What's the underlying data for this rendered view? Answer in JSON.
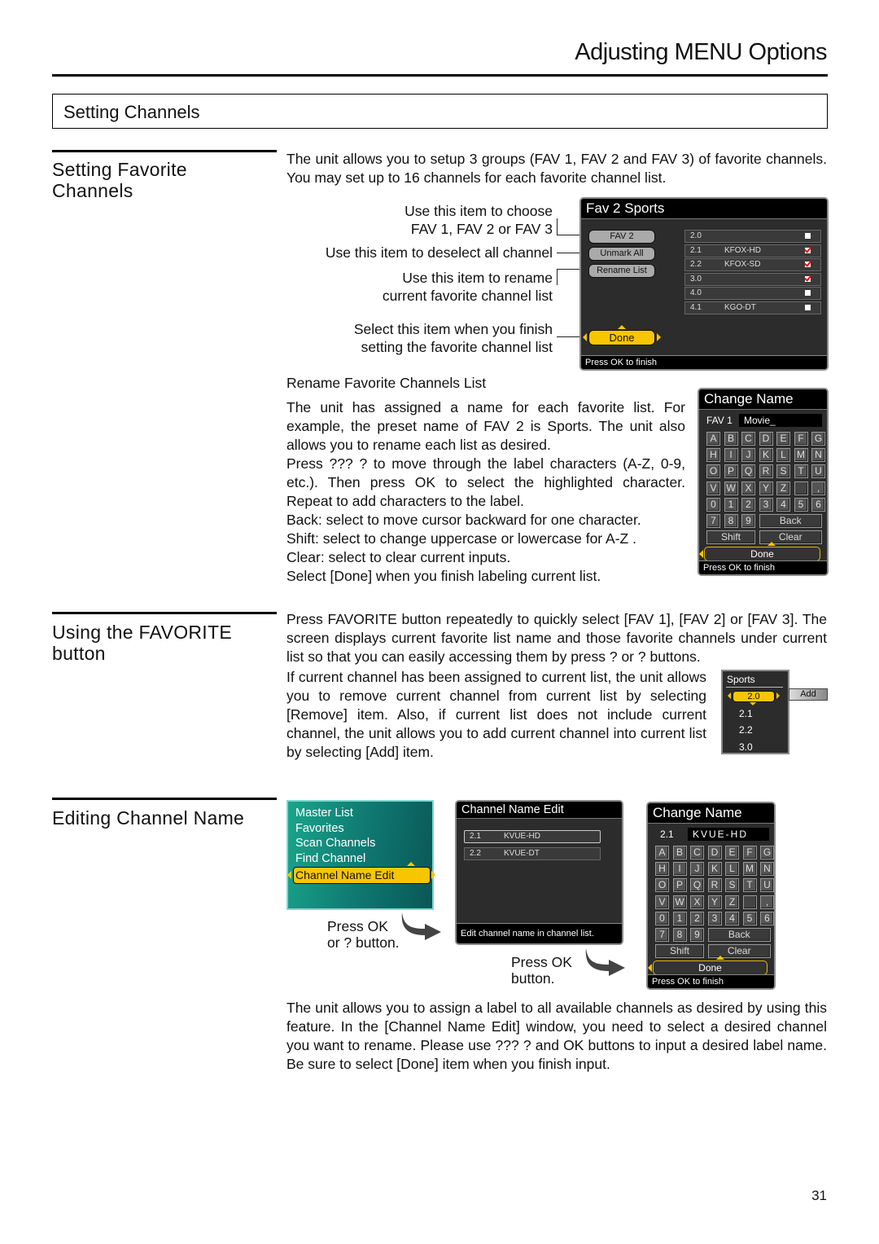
{
  "header": {
    "title": "Adjusting MENU Options"
  },
  "section": {
    "title": "Setting Channels"
  },
  "fav_section": {
    "heading": [
      "Setting Favorite",
      "Channels"
    ],
    "intro": "The unit allows you to setup 3 groups (FAV 1, FAV 2 and FAV 3) of favorite channels. You may set up to 16 channels for each favorite channel list.",
    "callouts": {
      "choose": [
        "Use this item to choose",
        "FAV 1, FAV 2 or FAV 3"
      ],
      "deselect": "Use this item to deselect all channel",
      "rename": [
        "Use this item to rename",
        "current favorite channel list"
      ],
      "finish": [
        "Select this item when you finish",
        "setting the favorite channel list"
      ]
    },
    "osd": {
      "title": "Fav 2 Sports",
      "buttons": {
        "fav": "FAV 2",
        "unmark": "Unmark All",
        "rename": "Rename List",
        "done": "Done"
      },
      "channels": [
        {
          "num": "2.0",
          "name": "",
          "checked": false
        },
        {
          "num": "2.1",
          "name": "KFOX-HD",
          "checked": true
        },
        {
          "num": "2.2",
          "name": "KFOX-SD",
          "checked": true
        },
        {
          "num": "3.0",
          "name": "",
          "checked": true
        },
        {
          "num": "4.0",
          "name": "",
          "checked": false
        },
        {
          "num": "4.1",
          "name": "KGO-DT",
          "checked": false
        }
      ],
      "footer": "Press OK to finish"
    }
  },
  "rename_section": {
    "subheading": "Rename Favorite Channels List",
    "paragraphs": [
      "The unit has assigned a name for each favorite list. For example, the preset name of FAV 2 is Sports. The unit also allows you to rename each list as desired.",
      "Press ??? ? to move through the label characters (A-Z, 0-9, etc.). Then press OK to select the highlighted character. Repeat to add characters to the label.",
      "Back: select to move cursor backward for one character.",
      "Shift: select to change uppercase or lowercase for A-Z .",
      "Clear: select to clear current inputs.",
      "Select [Done] when you finish labeling current list."
    ],
    "osd": {
      "title": "Change Name",
      "label": "FAV 1",
      "value": "Movie_",
      "footer": "Press OK to finish"
    }
  },
  "keyboard": {
    "rows": [
      [
        "A",
        "B",
        "C",
        "D",
        "E",
        "F",
        "G"
      ],
      [
        "H",
        "I",
        "J",
        "K",
        "L",
        "M",
        "N"
      ],
      [
        "O",
        "P",
        "Q",
        "R",
        "S",
        "T",
        "U"
      ],
      [
        "V",
        "W",
        "X",
        "Y",
        "Z",
        " ",
        ","
      ],
      [
        "0",
        "1",
        "2",
        "3",
        "4",
        "5",
        "6"
      ],
      [
        "7",
        "8",
        "9"
      ]
    ],
    "back": "Back",
    "shift": "Shift",
    "clear": "Clear",
    "done": "Done"
  },
  "favorite_button_section": {
    "heading": [
      "Using the FAVORITE",
      "button"
    ],
    "paragraph1": "Press FAVORITE button repeatedly to quickly select [FAV 1], [FAV 2] or [FAV 3]. The screen displays current favorite list name and those favorite channels under current list so that you can easily accessing them by press ? or ? buttons.",
    "paragraph2": "If current channel has been assigned to current list, the unit allows you to remove current channel from current list by selecting [Remove] item. Also, if current list does not include current channel, the unit allows you to add current channel into current list by selecting [Add] item.",
    "osd": {
      "title": "Sports",
      "channels": [
        "2.0",
        "2.1",
        "2.2",
        "3.0"
      ],
      "selected": "2.0",
      "add_button": "Add"
    }
  },
  "edit_section": {
    "heading": "Editing Channel Name",
    "menu": {
      "items": [
        "Master List",
        "Favorites",
        "Scan Channels",
        "Find Channel",
        "Channel Name Edit"
      ],
      "selected": "Channel Name Edit"
    },
    "step1": [
      "Press OK",
      "or ? button."
    ],
    "channel_edit": {
      "title": "Channel Name Edit",
      "rows": [
        {
          "num": "2.1",
          "name": "KVUE-HD"
        },
        {
          "num": "2.2",
          "name": "KVUE-DT"
        }
      ],
      "footer": "Edit channel name in channel list."
    },
    "step2": [
      "Press OK",
      "button."
    ],
    "change_name": {
      "title": "Change Name",
      "label": "2.1",
      "value": "KVUE-HD",
      "footer": "Press OK to finish"
    },
    "paragraph": "The unit allows you to assign a label to all available channels as desired by using this feature. In the [Channel Name Edit] window, you need to select a desired channel you want to rename. Please use ??? ? and OK buttons to input a desired label name. Be sure to select [Done] item when you finish input."
  },
  "footer": {
    "page_number": "31"
  }
}
